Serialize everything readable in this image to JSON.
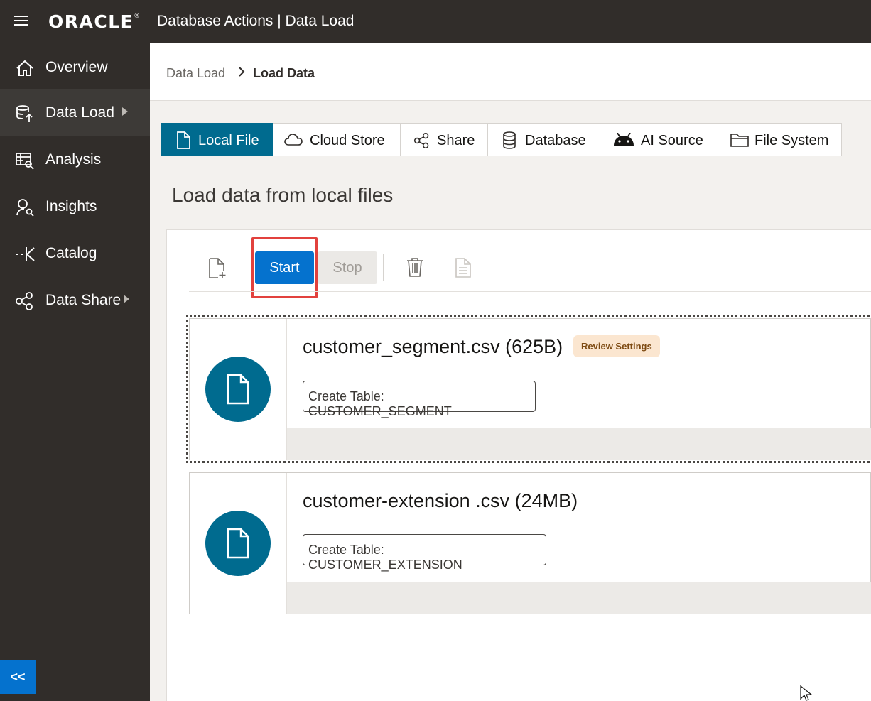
{
  "header": {
    "logo_text": "ORACLE",
    "logo_mark": "®",
    "app_title": "Database Actions |  Data Load"
  },
  "sidebar": {
    "items": [
      {
        "label": "Overview",
        "icon": "home-icon"
      },
      {
        "label": "Data Load",
        "icon": "data-load-icon"
      },
      {
        "label": "Analysis",
        "icon": "analysis-icon"
      },
      {
        "label": "Insights",
        "icon": "insights-icon"
      },
      {
        "label": "Catalog",
        "icon": "catalog-icon"
      },
      {
        "label": "Data Share",
        "icon": "share-icon"
      }
    ],
    "collapse_label": "<<"
  },
  "breadcrumb": {
    "parent": "Data Load",
    "current": "Load Data"
  },
  "tabs": [
    {
      "label": "Local File",
      "icon": "file-icon",
      "active": true
    },
    {
      "label": "Cloud Store",
      "icon": "cloud-icon"
    },
    {
      "label": "Share",
      "icon": "share-icon"
    },
    {
      "label": "Database",
      "icon": "database-icon"
    },
    {
      "label": "AI Source",
      "icon": "android-icon"
    },
    {
      "label": "File System",
      "icon": "folder-icon"
    }
  ],
  "page_heading": "Load data from local files",
  "toolbar": {
    "start_label": "Start",
    "stop_label": "Stop"
  },
  "files": [
    {
      "name": "customer_segment.csv (625B)",
      "badge": "Review Settings",
      "table_label": "Create Table: CUSTOMER_SEGMENT"
    },
    {
      "name": "customer-extension .csv (24MB)",
      "table_label": "Create Table: CUSTOMER_EXTENSION"
    }
  ],
  "colors": {
    "topbar": "#312d2a",
    "accent_teal": "#006b8f",
    "primary_blue": "#0572ce",
    "highlight_red": "#e2413d"
  }
}
